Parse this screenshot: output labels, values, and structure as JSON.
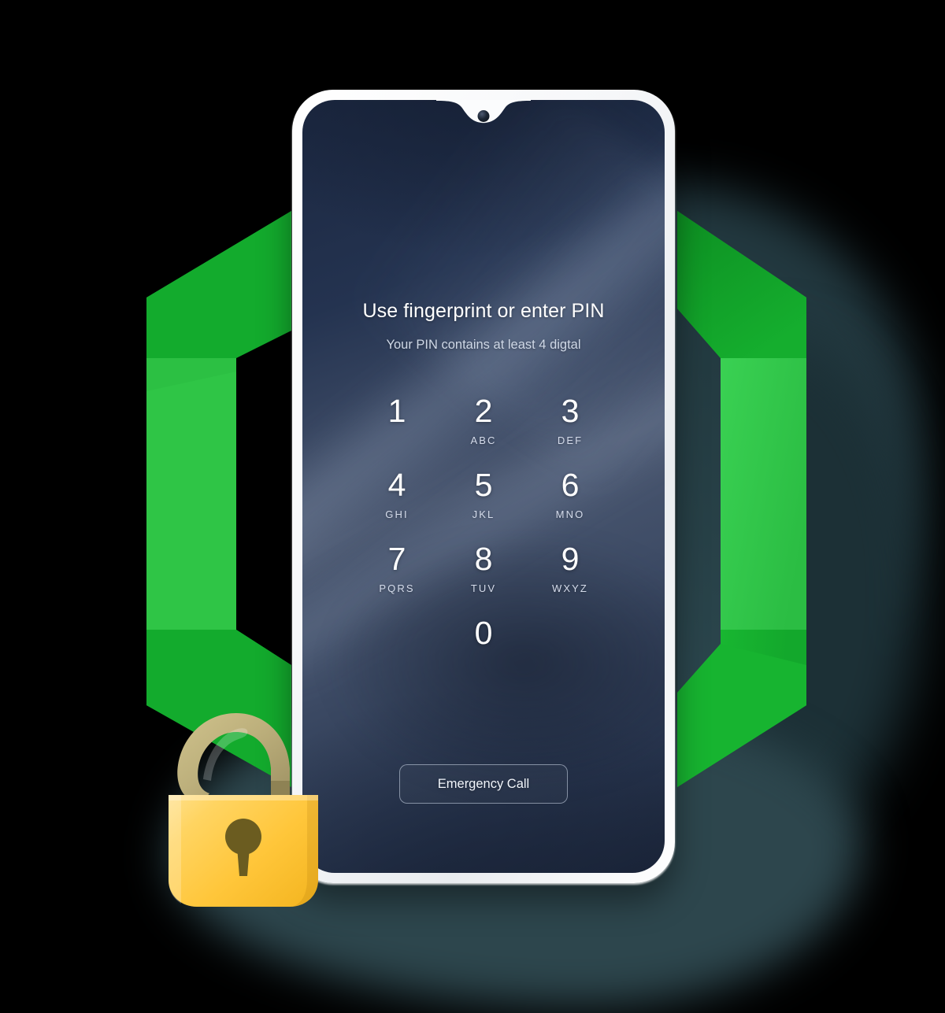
{
  "scene": {
    "background_color": "#000000",
    "shadow_color": "#2b444b"
  },
  "badge": {
    "name": "hexagon-ring",
    "colors": {
      "face_dark": "#12a52b",
      "face_mid": "#19b832",
      "face_light": "#35c84b",
      "face_bright": "#3ad152",
      "edge_dark": "#0f9225"
    }
  },
  "padlock": {
    "name": "open-padlock",
    "state": "unlocked",
    "body_color": "#ffc83d",
    "body_highlight": "#ffd96b",
    "shackle_color": "#b9ad79",
    "keyhole_color": "#6b5c20"
  },
  "phone": {
    "frame_color": "#ffffff",
    "screen_top_color": "#1b2740",
    "screen_mid_color": "#4a5770",
    "notch_icon": "front-camera",
    "speaker_icon": "earpiece-speaker"
  },
  "lockscreen": {
    "title": "Use fingerprint or enter PIN",
    "subtitle": "Your PIN contains at least 4 digtal",
    "keypad": [
      {
        "digit": "1",
        "letters": ""
      },
      {
        "digit": "2",
        "letters": "ABC"
      },
      {
        "digit": "3",
        "letters": "DEF"
      },
      {
        "digit": "4",
        "letters": "GHI"
      },
      {
        "digit": "5",
        "letters": "JKL"
      },
      {
        "digit": "6",
        "letters": "MNO"
      },
      {
        "digit": "7",
        "letters": "PQRS"
      },
      {
        "digit": "8",
        "letters": "TUV"
      },
      {
        "digit": "9",
        "letters": "WXYZ"
      },
      {
        "digit": "0",
        "letters": ""
      }
    ],
    "emergency_call_label": "Emergency Call"
  }
}
